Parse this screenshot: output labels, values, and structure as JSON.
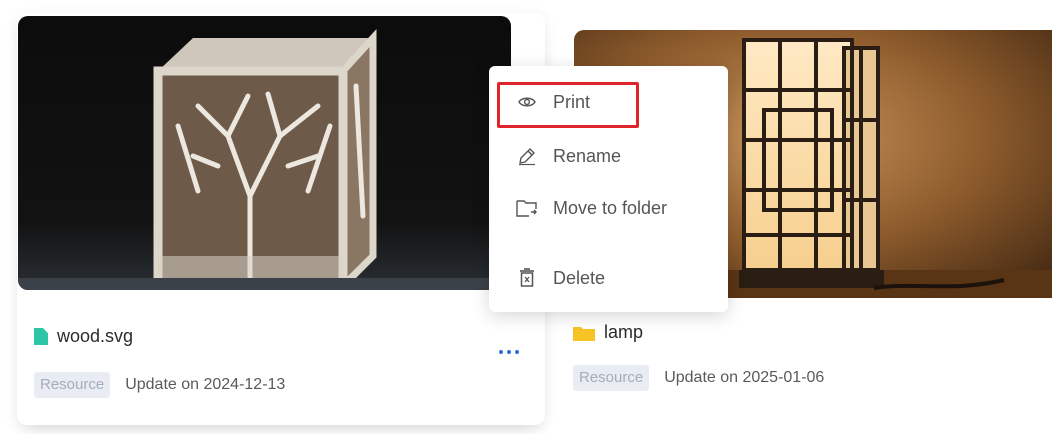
{
  "cards": [
    {
      "file_name": "wood.svg",
      "file_icon": "file-icon",
      "badge": "Resource",
      "updated": "Update on 2024-12-13",
      "thumbnail_alt": "laser-cut wooden lantern with tree pattern"
    },
    {
      "file_name": "lamp",
      "file_icon": "folder-icon",
      "badge": "Resource",
      "updated": "Update on 2025-01-06",
      "thumbnail_alt": "wooden lattice floor lamp"
    }
  ],
  "context_menu": {
    "items": [
      {
        "label": "Print",
        "icon": "eye-icon"
      },
      {
        "label": "Rename",
        "icon": "pencil-icon"
      },
      {
        "label": "Move to folder",
        "icon": "move-folder-icon"
      },
      {
        "label": "Delete",
        "icon": "trash-icon"
      }
    ],
    "highlighted_item": "Print"
  },
  "colors": {
    "accent_blue": "#2f6fd6",
    "file_icon_green": "#2ec4a6",
    "folder_yellow": "#f7c325",
    "highlight_red": "#e0242b",
    "badge_bg": "#e9edf3"
  }
}
